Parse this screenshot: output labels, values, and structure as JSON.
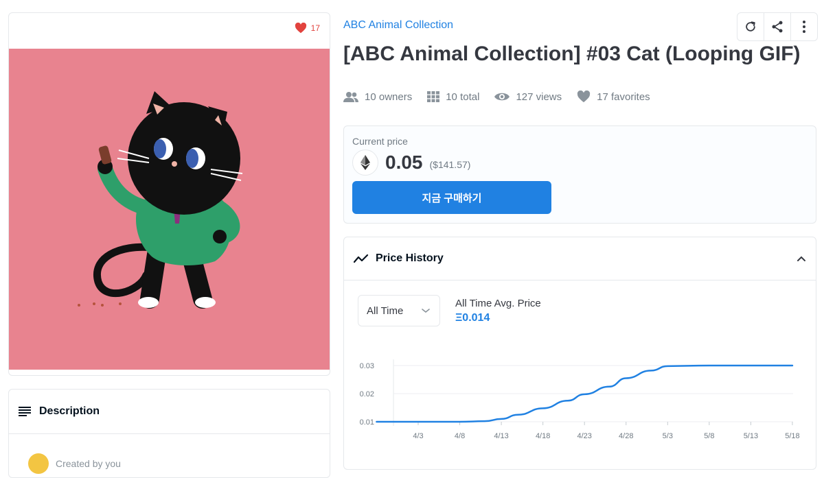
{
  "item": {
    "favorites_count": "17",
    "collection_name": "ABC Animal Collection",
    "title": "[ABC Animal Collection] #03 Cat (Looping GIF)"
  },
  "stats": {
    "owners": "10 owners",
    "total": "10 total",
    "views": "127 views",
    "favorites": "17 favorites"
  },
  "price": {
    "label": "Current price",
    "value": "0.05",
    "usd": "($141.57)",
    "buy_label": "지금 구매하기"
  },
  "description": {
    "title": "Description",
    "created_by": "Created by you"
  },
  "price_history": {
    "title": "Price History",
    "range": "All Time",
    "avg_label": "All Time Avg. Price",
    "avg_value": "Ξ0.014"
  },
  "icons": {
    "heart": "heart-icon",
    "refresh": "refresh-icon",
    "share": "share-icon",
    "more": "more-vertical-icon",
    "eth": "ethereum-icon"
  },
  "colors": {
    "accent": "#2081e2",
    "heart": "#e2433e",
    "artwork_bg": "#e8838f"
  },
  "chart_data": {
    "type": "line",
    "x_ticks": [
      "4/3",
      "4/8",
      "4/13",
      "4/18",
      "4/23",
      "4/28",
      "5/3",
      "5/8",
      "5/13",
      "5/18"
    ],
    "y_ticks": [
      "0.01",
      "0.02",
      "0.03"
    ],
    "ylim": [
      0.01,
      0.03
    ],
    "grid": true,
    "x": [
      "3/29",
      "4/3",
      "4/8",
      "4/11",
      "4/13",
      "4/15",
      "4/18",
      "4/21",
      "4/23",
      "4/26",
      "4/28",
      "5/1",
      "5/3",
      "5/8",
      "5/13",
      "5/18"
    ],
    "values": [
      0.01,
      0.01,
      0.01,
      0.0102,
      0.011,
      0.0125,
      0.0148,
      0.0175,
      0.0198,
      0.0225,
      0.0255,
      0.0282,
      0.0298,
      0.03,
      0.03,
      0.03
    ]
  }
}
